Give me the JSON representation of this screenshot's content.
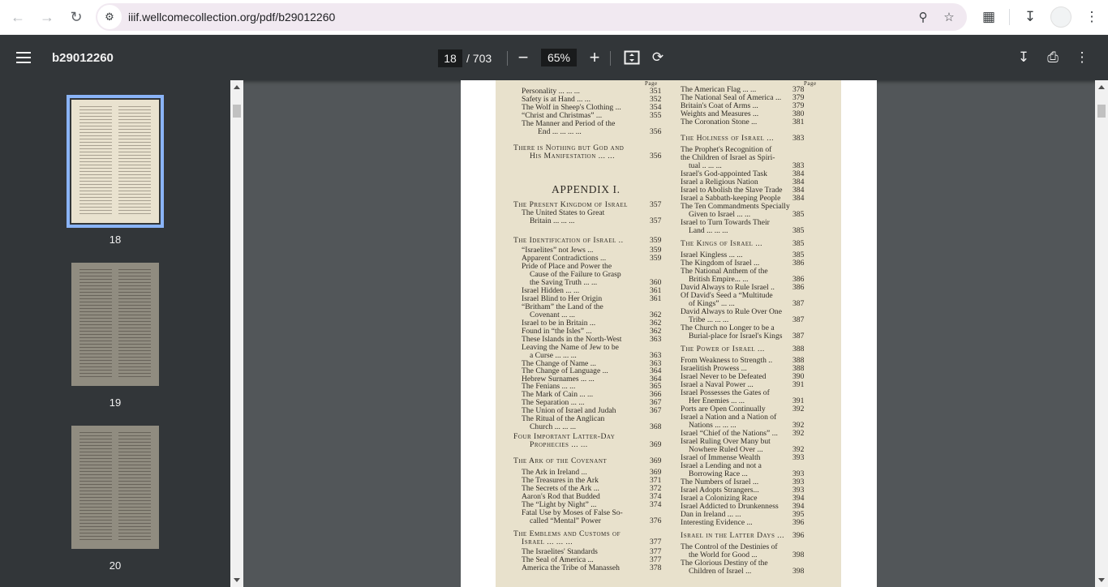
{
  "browser": {
    "url": "iiif.wellcomecollection.org/pdf/b29012260"
  },
  "toolbar": {
    "title": "b29012260",
    "current_page": "18",
    "total_pages": "/ 703",
    "zoom": "65%"
  },
  "thumbnails": [
    {
      "label": "18",
      "selected": true
    },
    {
      "label": "19",
      "selected": false
    },
    {
      "label": "20",
      "selected": false
    }
  ],
  "page": {
    "page_header": "Page",
    "appendix_title": "APPENDIX I.",
    "left_rows": [
      {
        "text": "Personality  ...  ...  ...",
        "num": "351"
      },
      {
        "text": "Safety is at Hand  ...  ...",
        "num": "352"
      },
      {
        "text": "The Wolf in Sheep's Clothing ...",
        "num": "354"
      },
      {
        "text": "“Christ and Christmas”  ...",
        "num": "355"
      },
      {
        "text": "The Manner and Period of the",
        "num": ""
      },
      {
        "text": "End  ...  ...  ...  ...",
        "num": "356"
      },
      {
        "text": "There is Nothing but God and",
        "num": ""
      },
      {
        "text": "His Manifestation ...  ...",
        "num": "356"
      },
      {
        "text": "The Present Kingdom of Israel",
        "num": "357"
      },
      {
        "text": "The United States to Great",
        "num": ""
      },
      {
        "text": "Britain  ...  ...  ...",
        "num": "357"
      },
      {
        "text": "The Identification of Israel ..",
        "num": "359"
      },
      {
        "text": "“Israelites” not Jews  ...",
        "num": "359"
      },
      {
        "text": "Apparent Contradictions  ...",
        "num": "359"
      },
      {
        "text": "Pride of Place and Power the",
        "num": ""
      },
      {
        "text": "Cause of the Failure to Grasp",
        "num": ""
      },
      {
        "text": "the Saving Truth  ...  ...",
        "num": "360"
      },
      {
        "text": "Israel Hidden  ...  ...",
        "num": "361"
      },
      {
        "text": "Israel Blind to Her Origin",
        "num": "361"
      },
      {
        "text": "“Britham” the Land of the",
        "num": ""
      },
      {
        "text": "Covenant  ...  ...",
        "num": "362"
      },
      {
        "text": "Israel to be in Britain  ...",
        "num": "362"
      },
      {
        "text": "Found in “the Isles”  ...",
        "num": "362"
      },
      {
        "text": "These Islands in the North-West",
        "num": "363"
      },
      {
        "text": "Leaving the Name of Jew to be",
        "num": ""
      },
      {
        "text": "a Curse ...  ...  ...",
        "num": "363"
      },
      {
        "text": "The Change of Name  ...",
        "num": "363"
      },
      {
        "text": "The Change of Language  ...",
        "num": "364"
      },
      {
        "text": "Hebrew Surnames  ...  ...",
        "num": "364"
      },
      {
        "text": "The Fenians  ...  ...",
        "num": "365"
      },
      {
        "text": "The Mark of Cain  ...  ...",
        "num": "366"
      },
      {
        "text": "The Separation  ...  ...",
        "num": "367"
      },
      {
        "text": "The Union of Israel and Judah",
        "num": "367"
      },
      {
        "text": "The Ritual of the Anglican",
        "num": ""
      },
      {
        "text": "Church ...  ...  ...",
        "num": "368"
      },
      {
        "text": "Four Important Latter-Day",
        "num": ""
      },
      {
        "text": "Prophecies  ...  ...",
        "num": "369"
      },
      {
        "text": "The Ark of the Covenant",
        "num": "369"
      },
      {
        "text": "The Ark in Ireland  ...",
        "num": "369"
      },
      {
        "text": "The Treasures in the Ark",
        "num": "371"
      },
      {
        "text": "The Secrets of the Ark ...",
        "num": "372"
      },
      {
        "text": "Aaron's Rod that Budded",
        "num": "374"
      },
      {
        "text": "The “Light by Night”  ...",
        "num": "374"
      },
      {
        "text": "Fatal Use by Moses of False So-",
        "num": ""
      },
      {
        "text": "called “Mental” Power",
        "num": "376"
      },
      {
        "text": "The Emblems and Customs of",
        "num": ""
      },
      {
        "text": "Israel  ...  ...  ...",
        "num": "377"
      },
      {
        "text": "The Israelites' Standards",
        "num": "377"
      },
      {
        "text": "The Seal of America  ...",
        "num": "377"
      },
      {
        "text": "America the Tribe of Manasseh",
        "num": "378"
      }
    ],
    "right_rows": [
      {
        "text": "The American Flag  ...  ...",
        "num": "378"
      },
      {
        "text": "The National Seal of America ...",
        "num": "379"
      },
      {
        "text": "Britain's Coat of Arms ...",
        "num": "379"
      },
      {
        "text": "Weights and Measures  ...",
        "num": "380"
      },
      {
        "text": "The Coronation Stone  ...",
        "num": "381"
      },
      {
        "text": "The Holiness of Israel  ...",
        "num": "383"
      },
      {
        "text": "The Prophet's Recognition of",
        "num": ""
      },
      {
        "text": "the Children of Israel as Spiri-",
        "num": ""
      },
      {
        "text": "tual  ..  ...  ...",
        "num": "383"
      },
      {
        "text": "Israel's God-appointed Task",
        "num": "384"
      },
      {
        "text": "Israel a Religious Nation",
        "num": "384"
      },
      {
        "text": "Israel to Abolish the Slave Trade",
        "num": "384"
      },
      {
        "text": "Israel a Sabbath-keeping People",
        "num": "384"
      },
      {
        "text": "The Ten Commandments Specially",
        "num": ""
      },
      {
        "text": "Given to Israel ...  ...",
        "num": "385"
      },
      {
        "text": "Israel to Turn Towards Their",
        "num": ""
      },
      {
        "text": "Land  ...  ...  ...",
        "num": "385"
      },
      {
        "text": "The Kings of Israel  ...",
        "num": "385"
      },
      {
        "text": "Israel Kingless  ...  ...",
        "num": "385"
      },
      {
        "text": "The Kingdom of Israel ...",
        "num": "386"
      },
      {
        "text": "The National Anthem of the",
        "num": ""
      },
      {
        "text": "British Empire...  ...",
        "num": "386"
      },
      {
        "text": "David Always to Rule Israel ..",
        "num": "386"
      },
      {
        "text": "Of David's Seed a “Multitude",
        "num": ""
      },
      {
        "text": "of Kings”  ...  ...",
        "num": "387"
      },
      {
        "text": "David Always to Rule Over One",
        "num": ""
      },
      {
        "text": "Tribe  ...  ...  ...",
        "num": "387"
      },
      {
        "text": "The Church no Longer to be a",
        "num": ""
      },
      {
        "text": "Burial-place for Israel's Kings",
        "num": "387"
      },
      {
        "text": "The Power of Israel  ...",
        "num": "388"
      },
      {
        "text": "From Weakness to Strength ..",
        "num": "388"
      },
      {
        "text": "Israelitish Prowess  ...",
        "num": "388"
      },
      {
        "text": "Israel Never to be Defeated",
        "num": "390"
      },
      {
        "text": "Israel a Naval Power  ...",
        "num": "391"
      },
      {
        "text": "Israel Possesses the Gates of",
        "num": ""
      },
      {
        "text": "Her Enemies  ...  ...",
        "num": "391"
      },
      {
        "text": "Ports are Open Continually",
        "num": "392"
      },
      {
        "text": "Israel a Nation and a Nation of",
        "num": ""
      },
      {
        "text": "Nations ...  ...  ...",
        "num": "392"
      },
      {
        "text": "Israel “Chief of the Nations” ...",
        "num": "392"
      },
      {
        "text": "Israel Ruling Over Many but",
        "num": ""
      },
      {
        "text": "Nowhere Ruled Over  ...",
        "num": "392"
      },
      {
        "text": "Israel of Immense Wealth",
        "num": "393"
      },
      {
        "text": "Israel a Lending and not a",
        "num": ""
      },
      {
        "text": "Borrowing Race  ...",
        "num": "393"
      },
      {
        "text": "The Numbers of Israel ...",
        "num": "393"
      },
      {
        "text": "Israel Adopts Strangers...",
        "num": "393"
      },
      {
        "text": "Israel a Colonizing Race",
        "num": "394"
      },
      {
        "text": "Israel Addicted to Drunkenness",
        "num": "394"
      },
      {
        "text": "Dan in Ireland  ...  ...",
        "num": "395"
      },
      {
        "text": "Interesting Evidence  ...",
        "num": "396"
      },
      {
        "text": "Israel in the Latter Days ...",
        "num": "396"
      },
      {
        "text": "The Control of the Destinies of",
        "num": ""
      },
      {
        "text": "the World for Good  ...",
        "num": "398"
      },
      {
        "text": "The Glorious Destiny of the",
        "num": ""
      },
      {
        "text": "Children of Israel  ...",
        "num": "398"
      }
    ]
  }
}
